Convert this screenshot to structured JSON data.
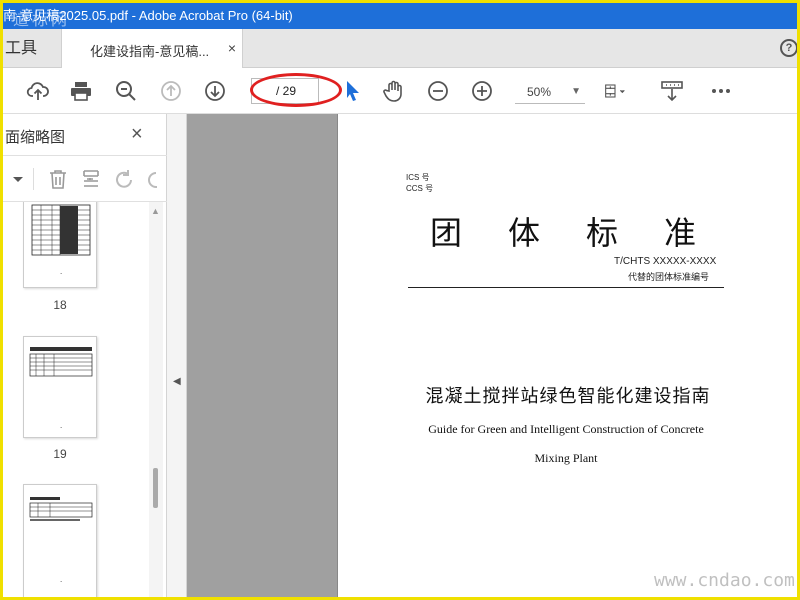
{
  "window": {
    "title": "南-意见稿2025.05.pdf - Adobe Acrobat Pro (64-bit)",
    "watermark_top": "道标网"
  },
  "tabs": {
    "tools": "工具",
    "document": "化建设指南-意见稿...",
    "close": "×",
    "help": "?"
  },
  "toolbar": {
    "page_current": "",
    "page_total": "/ 29",
    "zoom": "50%",
    "icons": [
      "cloud-upload-icon",
      "print-icon",
      "zoom-search-icon",
      "page-up-icon",
      "page-down-icon",
      "select-cursor-icon",
      "hand-tool-icon",
      "zoom-out-icon",
      "zoom-in-icon",
      "page-fit-icon",
      "scroll-mode-icon",
      "more-icon"
    ]
  },
  "sidebar": {
    "title": "面缩略图",
    "close": "×",
    "thumbnails": [
      {
        "label": "18",
        "dot": "."
      },
      {
        "label": "19",
        "dot": "."
      },
      {
        "label": "",
        "dot": "."
      }
    ]
  },
  "document": {
    "ics": "ICS 号",
    "ccs": "CCS 号",
    "std_title": "团体标准",
    "std_code": "T/CHTS  XXXXX-XXXX",
    "replace_note": "代替的团体标准编号",
    "title_cn": "混凝土搅拌站绿色智能化建设指南",
    "title_en_line1": "Guide for Green and Intelligent Construction of Concrete",
    "title_en_line2": "Mixing Plant"
  },
  "watermark_bottom": "www.cndao.com",
  "colors": {
    "titlebar": "#1e6fd9",
    "highlight": "#e02020",
    "frame": "#f0e000",
    "gray_area": "#a0a0a0"
  }
}
